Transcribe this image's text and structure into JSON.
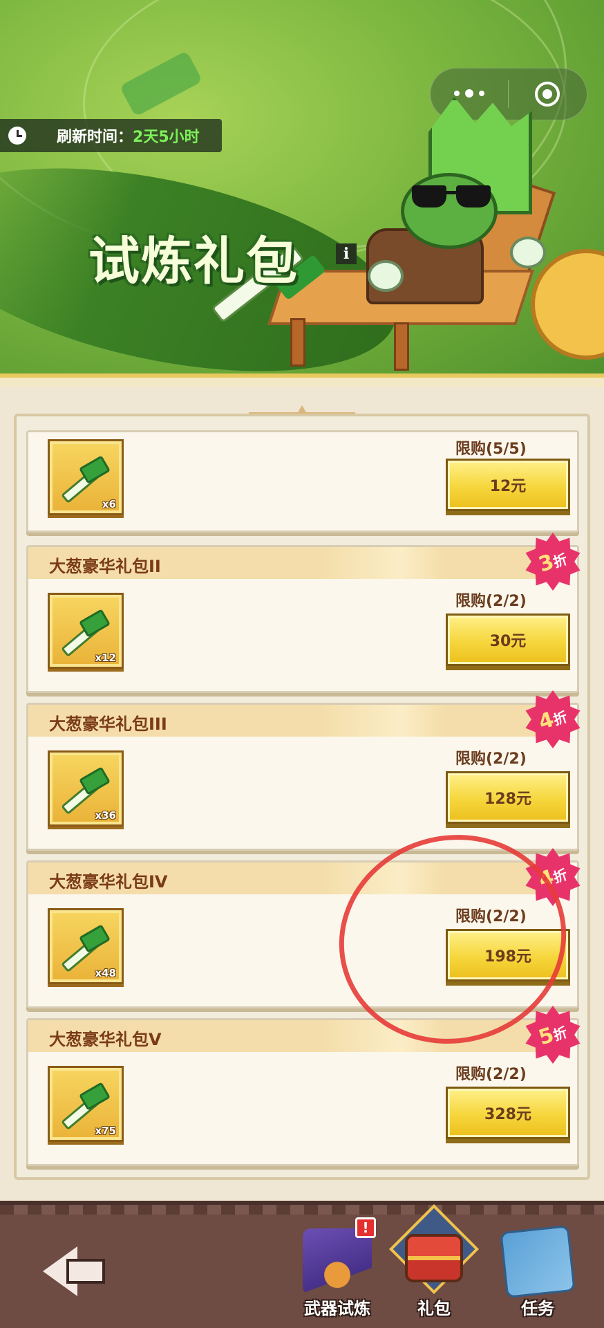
{
  "header": {
    "refresh_label": "刷新时间：",
    "refresh_value": "2天5小时",
    "title": "试炼礼包",
    "info_glyph": "i"
  },
  "packs": [
    {
      "title": "",
      "qty": "x6",
      "limit": "限购(5/5)",
      "price": "12元",
      "discount": null
    },
    {
      "title": "大葱豪华礼包II",
      "qty": "x12",
      "limit": "限购(2/2)",
      "price": "30元",
      "discount": {
        "num": "3",
        "unit": "折"
      }
    },
    {
      "title": "大葱豪华礼包III",
      "qty": "x36",
      "limit": "限购(2/2)",
      "price": "128元",
      "discount": {
        "num": "4",
        "unit": "折"
      }
    },
    {
      "title": "大葱豪华礼包IV",
      "qty": "x48",
      "limit": "限购(2/2)",
      "price": "198元",
      "discount": {
        "num": "4",
        "unit": "折"
      }
    },
    {
      "title": "大葱豪华礼包V",
      "qty": "x75",
      "limit": "限购(2/2)",
      "price": "328元",
      "discount": {
        "num": "5",
        "unit": "折"
      }
    }
  ],
  "bottom_nav": {
    "items": [
      {
        "label": "武器试炼",
        "icon": "witch-hat-icon",
        "alert": "!"
      },
      {
        "label": "礼包",
        "icon": "treasure-chest-icon"
      },
      {
        "label": "任务",
        "icon": "quest-map-icon"
      }
    ]
  },
  "colors": {
    "banner_green": "#7bb63f",
    "card_header": "#f4ddaa",
    "title_brown": "#7a3b16",
    "button_yellow": "#f6d63c",
    "discount_pink": "#e8336a",
    "annotation_red": "#e53b38",
    "footer_brown": "#6e4b43"
  }
}
